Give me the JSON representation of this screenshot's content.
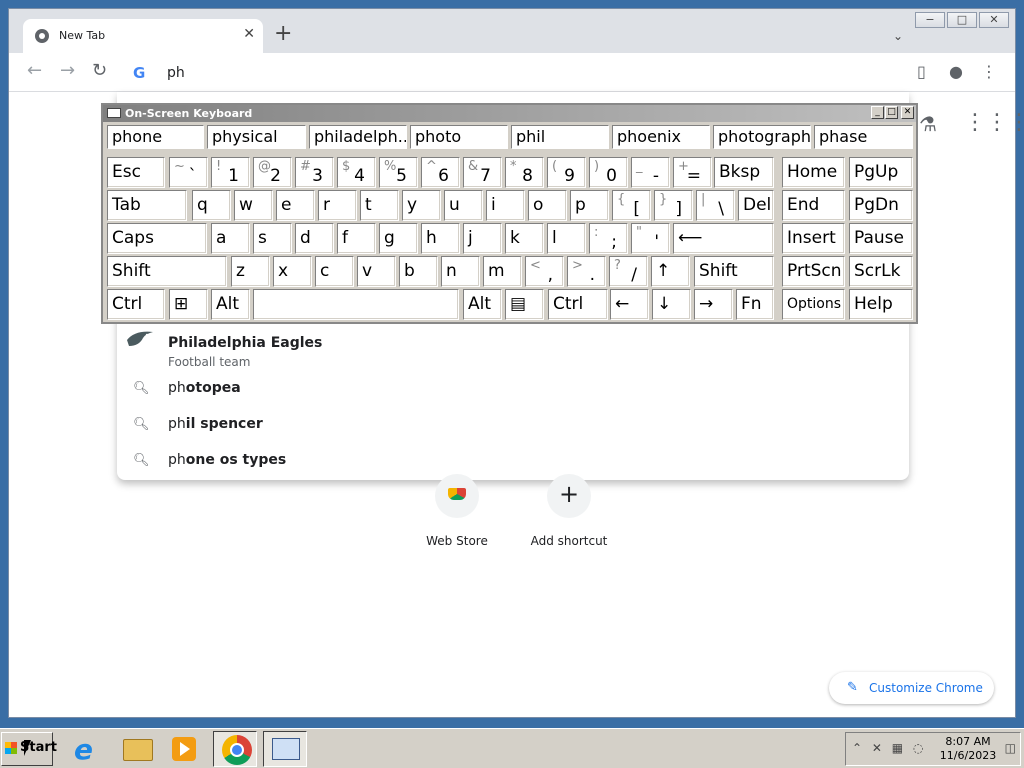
{
  "browser": {
    "tab_title": "New Tab",
    "tab_close": "✕",
    "new_tab": "+",
    "tab_search": "⌄",
    "window_controls": [
      "−",
      "□",
      "✕"
    ],
    "nav": {
      "back": "←",
      "forward": "→",
      "reload": "↻"
    },
    "omnibox_text": "ph",
    "omnibox_logo": "G",
    "sidepanel_icon": "▯",
    "profile_icon": "●",
    "menu_icon": "⋮"
  },
  "ntp": {
    "labs_icon": "⚗",
    "apps_icon": "⋮⋮⋮",
    "suggestions": [
      {
        "prefix": "Ph",
        "rest": "iladelphia Eagles",
        "subtitle": "Football team"
      },
      {
        "prefix": "ph",
        "rest": "otopea"
      },
      {
        "prefix": "ph",
        "rest": "il spencer"
      },
      {
        "prefix": "ph",
        "rest": "one os types"
      }
    ],
    "shortcuts": [
      {
        "label": "Web Store"
      },
      {
        "label": "Add shortcut",
        "icon": "+"
      }
    ],
    "customize_label": "Customize Chrome",
    "customize_icon": "✎"
  },
  "osk": {
    "title": "On-Screen Keyboard",
    "title_controls": [
      "_",
      "□",
      "✕"
    ],
    "predictions": [
      "phone",
      "physical",
      "philadelph...",
      "photo",
      "phil",
      "phoenix",
      "photograph...",
      "phase"
    ],
    "keys": {
      "esc": "Esc",
      "bksp": "Bksp",
      "home": "Home",
      "pgup": "PgUp",
      "tab": "Tab",
      "del": "Del",
      "end": "End",
      "pgdn": "PgDn",
      "caps": "Caps",
      "enter": "⟵",
      "insert": "Insert",
      "pause": "Pause",
      "shift": "Shift",
      "shift_r": "Shift",
      "prtscn": "PrtScn",
      "scrlk": "ScrLk",
      "ctrl": "Ctrl",
      "win": "⊞",
      "alt": "Alt",
      "alt_r": "Alt",
      "menu": "▤",
      "ctrl_r": "Ctrl",
      "left": "←",
      "down": "↓",
      "right": "→",
      "fn": "Fn",
      "options": "Options",
      "help": "Help",
      "num": [
        {
          "s": "~",
          "c": "`"
        },
        {
          "s": "!",
          "c": "1"
        },
        {
          "s": "@",
          "c": "2"
        },
        {
          "s": "#",
          "c": "3"
        },
        {
          "s": "$",
          "c": "4"
        },
        {
          "s": "%",
          "c": "5"
        },
        {
          "s": "^",
          "c": "6"
        },
        {
          "s": "&",
          "c": "7"
        },
        {
          "s": "*",
          "c": "8"
        },
        {
          "s": "(",
          "c": "9"
        },
        {
          "s": ")",
          "c": "0"
        },
        {
          "s": "_",
          "c": "-"
        },
        {
          "s": "+",
          "c": "="
        }
      ],
      "row2": [
        "q",
        "w",
        "e",
        "r",
        "t",
        "y",
        "u",
        "i",
        "o",
        "p"
      ],
      "row2_sym": [
        {
          "s": "{",
          "c": "["
        },
        {
          "s": "}",
          "c": "]"
        },
        {
          "s": "|",
          "c": "\\"
        }
      ],
      "row3": [
        "a",
        "s",
        "d",
        "f",
        "g",
        "h",
        "j",
        "k",
        "l"
      ],
      "row3_sym": [
        {
          "s": ":",
          "c": ";"
        },
        {
          "s": "\"",
          "c": "'"
        }
      ],
      "row4": [
        "z",
        "x",
        "c",
        "v",
        "b",
        "n",
        "m"
      ],
      "row4_sym": [
        {
          "s": "<",
          "c": ","
        },
        {
          "s": ">",
          "c": "."
        },
        {
          "s": "?",
          "c": "/"
        }
      ],
      "up": "↑"
    }
  },
  "taskbar": {
    "start_label": "Start",
    "tray_icons": "⌃ ✕ ▦ ◌",
    "time": "8:07 AM",
    "date": "11/6/2023",
    "notify_icon": "◫"
  }
}
